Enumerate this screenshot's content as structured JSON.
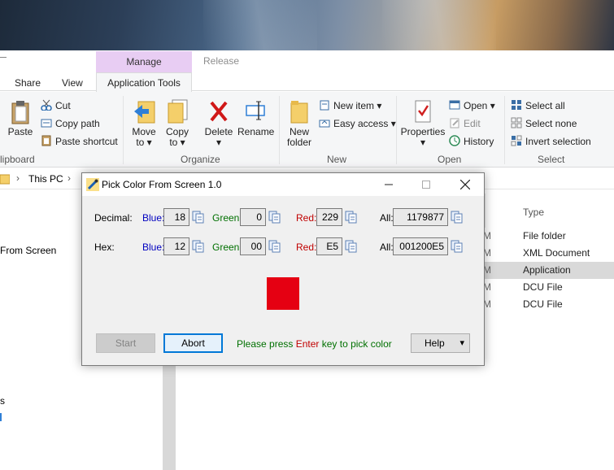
{
  "explorer": {
    "tabs": {
      "share": "Share",
      "view": "View",
      "manage": "Manage",
      "application_tools": "Application Tools",
      "release": "Release"
    },
    "ribbon": {
      "clipboard": {
        "paste": "Paste",
        "cut": "Cut",
        "copy_path": "Copy path",
        "paste_shortcut": "Paste shortcut",
        "group": "lipboard"
      },
      "organize": {
        "move_to": "Move",
        "move_to2": "to ▾",
        "copy_to": "Copy",
        "copy_to2": "to ▾",
        "delete": "Delete",
        "delete2": "▾",
        "rename": "Rename",
        "group": "Organize"
      },
      "new": {
        "new_folder": "New",
        "new_folder2": "folder",
        "new_item": "New item ▾",
        "easy_access": "Easy access ▾",
        "group": "New"
      },
      "open": {
        "properties": "Properties",
        "properties2": "▾",
        "open": "Open ▾",
        "edit": "Edit",
        "history": "History",
        "group": "Open"
      },
      "select": {
        "select_all": "Select all",
        "select_none": "Select none",
        "invert_selection": "Invert selection",
        "group": "Select"
      }
    },
    "address": {
      "this_pc": "This PC"
    },
    "left_pane": {
      "item1": "From Screen",
      "item2": "s"
    },
    "columns": {
      "type": "Type"
    },
    "files": [
      {
        "type": "File folder",
        "m": "M"
      },
      {
        "type": "XML Document",
        "m": "M"
      },
      {
        "type": "Application",
        "m": "M"
      },
      {
        "type": "DCU File",
        "m": "M"
      },
      {
        "type": "DCU File",
        "m": "M"
      }
    ]
  },
  "dialog": {
    "title": "Pick Color From Screen 1.0",
    "decimal": {
      "label": "Decimal:",
      "blue_label": "Blue:",
      "blue": "18",
      "green_label": "Green:",
      "green": "0",
      "red_label": "Red:",
      "red": "229",
      "all_label": "All:",
      "all": "1179877"
    },
    "hex": {
      "label": "Hex:",
      "blue_label": "Blue:",
      "blue": "12",
      "green_label": "Green:",
      "green": "00",
      "red_label": "Red:",
      "red": "E5",
      "all_label": "All:",
      "all": "001200E5"
    },
    "swatch_color": "#E50012",
    "buttons": {
      "start": "Start",
      "abort": "Abort",
      "help": "Help",
      "help_arrow": "▾"
    },
    "hint": {
      "pre": "Please press ",
      "key": "Enter",
      "post": " key to pick color"
    }
  }
}
